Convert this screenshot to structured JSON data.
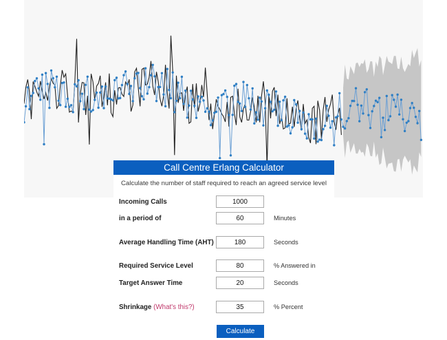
{
  "calculator": {
    "title": "Call Centre Erlang Calculator",
    "description": "Calculate the number of staff required to reach an agreed service level",
    "fields": {
      "incoming_calls": {
        "label": "Incoming Calls",
        "value": "1000",
        "unit": ""
      },
      "period": {
        "label": "in a period of",
        "value": "60",
        "unit": "Minutes"
      },
      "aht": {
        "label": "Average Handling Time (AHT)",
        "value": "180",
        "unit": "Seconds"
      },
      "service_level": {
        "label": "Required Service Level",
        "value": "80",
        "unit": "% Answered in"
      },
      "target_answer_time": {
        "label": "Target Answer Time",
        "value": "20",
        "unit": "Seconds"
      },
      "shrinkage": {
        "label": "Shrinkage",
        "link_text": "(What's this?)",
        "value": "35",
        "unit": "% Percent"
      }
    },
    "calculate_label": "Calculate"
  },
  "colors": {
    "header_bg": "#0b5fbf",
    "actual_line": "#222222",
    "forecast_line": "#6a9fd4",
    "forecast_points": "#2f7fc4",
    "confidence_band": "#9e9e9e",
    "link": "#c0386b"
  },
  "background_chart": {
    "type": "line",
    "description_series": [
      "actual",
      "forecast",
      "confidence_band"
    ]
  }
}
